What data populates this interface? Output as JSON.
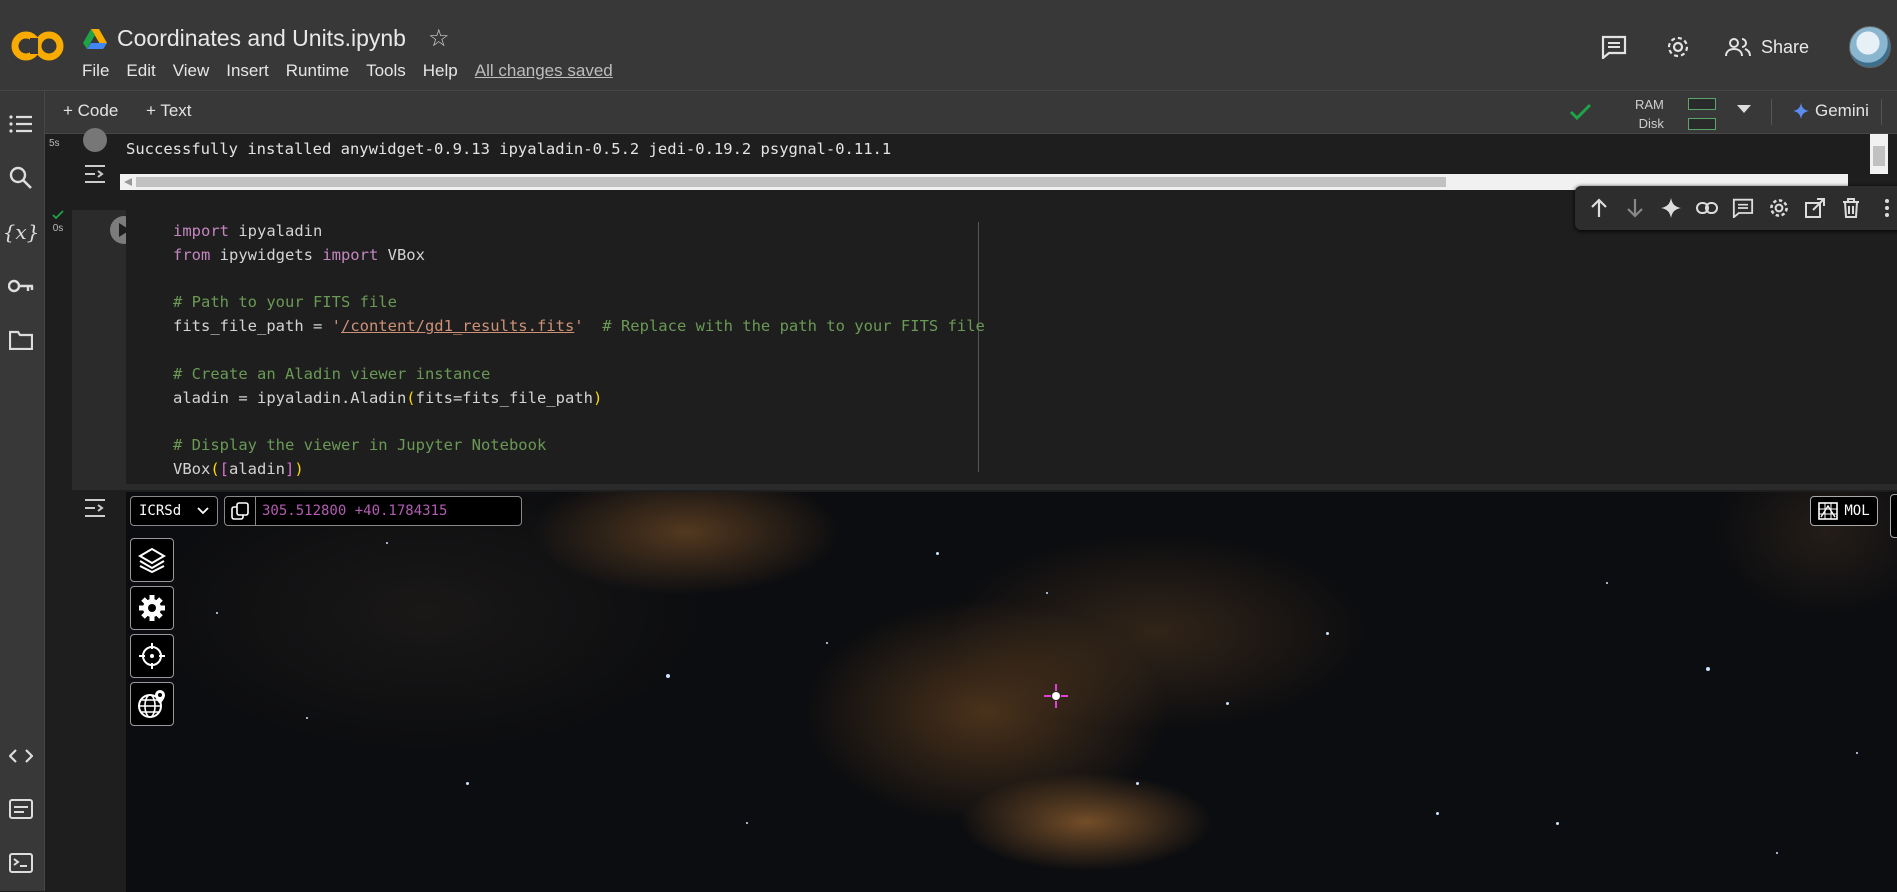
{
  "header": {
    "title": "Coordinates and Units.ipynb",
    "menu": [
      "File",
      "Edit",
      "View",
      "Insert",
      "Runtime",
      "Tools",
      "Help"
    ],
    "save_status": "All changes saved",
    "share_label": "Share"
  },
  "toolbar": {
    "add_code": "+ Code",
    "add_text": "+ Text",
    "ram_label": "RAM",
    "disk_label": "Disk",
    "gemini_label": "Gemini"
  },
  "cell1": {
    "exec_time": "5s",
    "output_line": "Successfully installed anywidget-0.9.13 ipyaladin-0.5.2 jedi-0.19.2 psygnal-0.11.1"
  },
  "cell2": {
    "exec_time": "0s",
    "code": {
      "l1_kw": "import",
      "l1_rest": " ipyaladin",
      "l2_kw1": "from",
      "l2_mid": " ipywidgets ",
      "l2_kw2": "import",
      "l2_rest": " VBox",
      "l4_cm": "# Path to your FITS file",
      "l5_pre": "fits_file_path = ",
      "l5_q1": "'",
      "l5_str": "/content/gd1_results.fits",
      "l5_q2": "'",
      "l5_cm": "  # Replace with the path to your FITS file",
      "l7_cm": "# Create an Aladin viewer instance",
      "l8_pre": "aladin = ipyaladin.Aladin",
      "l8_p1": "(",
      "l8_mid": "fits=fits_file_path",
      "l8_p2": ")",
      "l10_cm": "# Display the viewer in Jupyter Notebook",
      "l11_pre": "VBox",
      "l11_p1": "(",
      "l11_b1": "[",
      "l11_mid": "aladin",
      "l11_b2": "]",
      "l11_p2": ")"
    }
  },
  "aladin": {
    "frame": "ICRSd",
    "coordinates": "305.512800 +40.1784315",
    "survey_label": "MOL"
  },
  "colors": {
    "accent": "#f9ab00",
    "check": "#1ea446",
    "coord_text": "#b35cb3"
  }
}
